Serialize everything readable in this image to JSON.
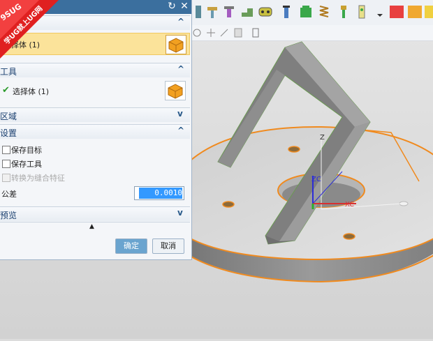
{
  "watermark": {
    "line1": "9SUG",
    "line2": "学UG就上UG网",
    "color": "#e02020"
  },
  "title_buttons": {
    "reset": "↻",
    "close": "✕"
  },
  "target_section": {
    "title": "目标",
    "select_label": "选择体 (1)"
  },
  "tool_section": {
    "title": "工具",
    "select_label": "选择体 (1)"
  },
  "region_section": {
    "title": "区域"
  },
  "settings_section": {
    "title": "设置",
    "keep_target": "保存目标",
    "keep_tool": "保存工具",
    "convert_seam": "转换为缝合特征",
    "tolerance_label": "公差",
    "tolerance_value": "0.0010"
  },
  "preview_section": {
    "title": "预览"
  },
  "buttons": {
    "ok": "确定",
    "cancel": "取消"
  },
  "axis_labels": {
    "z": "Z",
    "zc": "ZC",
    "xc": "XC"
  },
  "colors": {
    "accent_orange": "#f08a1e",
    "title_blue": "#3b6f9e",
    "highlight_row": "#fbe39a",
    "ok_button": "#6aa4cf"
  }
}
